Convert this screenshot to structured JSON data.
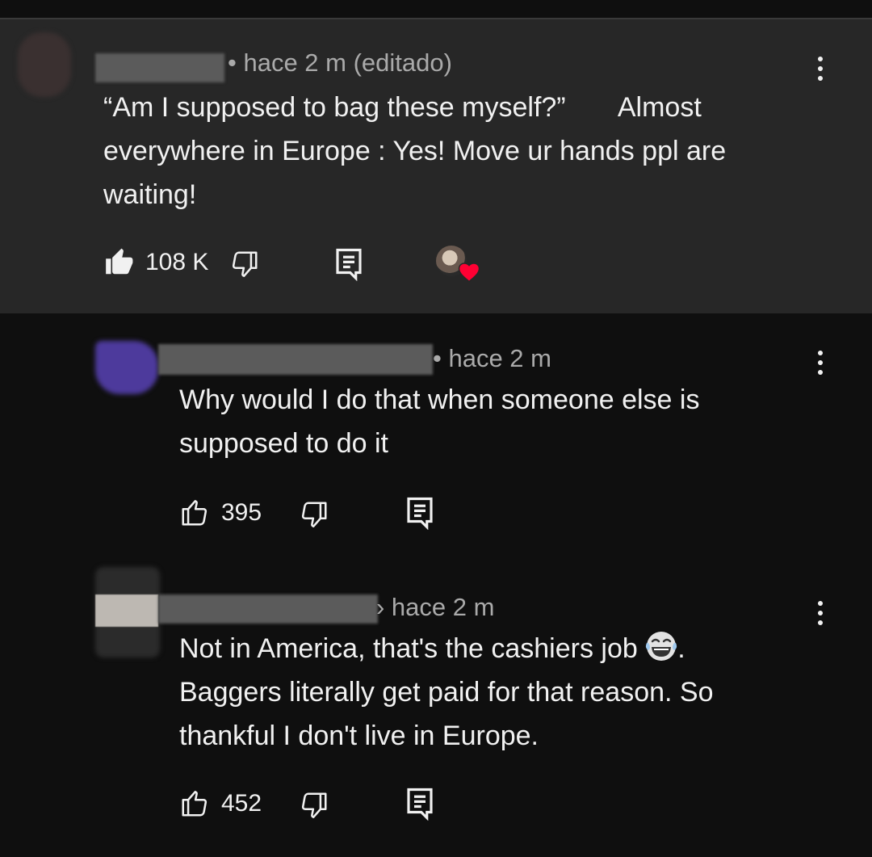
{
  "comments": [
    {
      "meta": "• hace 2 m (editado)",
      "lines": [
        "“Am I supposed to bag these myself?”       Almost",
        "everywhere in Europe : Yes! Move ur hands ppl are",
        "waiting!"
      ],
      "likes": "108 K",
      "liked": true,
      "creator_heart": true
    },
    {
      "meta": "• hace 2 m",
      "lines": [
        "Why would I do that when someone else is",
        "supposed to do it"
      ],
      "likes": "395",
      "liked": false
    },
    {
      "meta": "› hace 2 m",
      "lines": [
        "Not in America, that's the cashiers job",
        "Baggers literally get paid for that reason. So",
        "thankful I don't live in Europe."
      ],
      "line1_suffix": ".",
      "emoji": "face-with-tears-of-joy-icon",
      "likes": "452",
      "liked": false
    }
  ],
  "colors": {
    "background": "#0f0f0f",
    "highlight_background": "#272727",
    "text": "#f1f1f1",
    "meta_text": "#aaaaaa",
    "heart": "#ff0033"
  }
}
